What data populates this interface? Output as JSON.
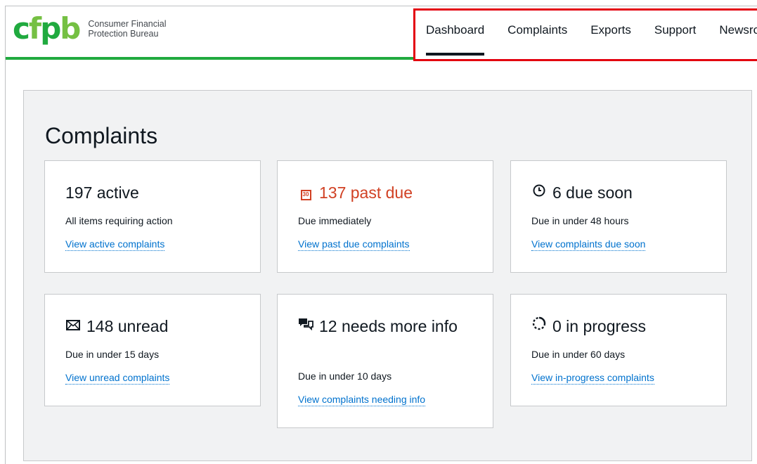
{
  "header": {
    "logo_mark": "cfpb",
    "logo_line1": "Consumer Financial",
    "logo_line2": "Protection Bureau"
  },
  "nav": {
    "items": [
      {
        "label": "Dashboard",
        "active": true
      },
      {
        "label": "Complaints"
      },
      {
        "label": "Exports"
      },
      {
        "label": "Support"
      },
      {
        "label": "Newsroom"
      }
    ]
  },
  "panel": {
    "title": "Complaints",
    "cards": [
      {
        "icon": "none",
        "count_label": "197 active",
        "description": "All items requiring action",
        "link": "View active complaints"
      },
      {
        "icon": "calendar-icon",
        "icon_text": "30",
        "count_label": "137 past due",
        "description": "Due immediately",
        "link": "View past due complaints",
        "accent": "#d14124"
      },
      {
        "icon": "clock-icon",
        "count_label": "6 due soon",
        "description": "Due in under 48 hours",
        "link": "View complaints due soon"
      },
      {
        "icon": "envelope-icon",
        "count_label": "148 unread",
        "description": "Due in under 15 days",
        "link": "View unread complaints"
      },
      {
        "icon": "chat-bubbles-icon",
        "count_label": "12 needs more info",
        "description": "Due in under 10 days",
        "link": "View complaints needing info"
      },
      {
        "icon": "in-progress-icon",
        "count_label": "0 in progress",
        "description": "Due in under 60 days",
        "link": "View in-progress complaints"
      }
    ]
  },
  "colors": {
    "brand_green": "#20aa3f",
    "link_blue": "#0072ce",
    "past_due_red": "#d14124",
    "highlight_red": "#e3000f"
  }
}
